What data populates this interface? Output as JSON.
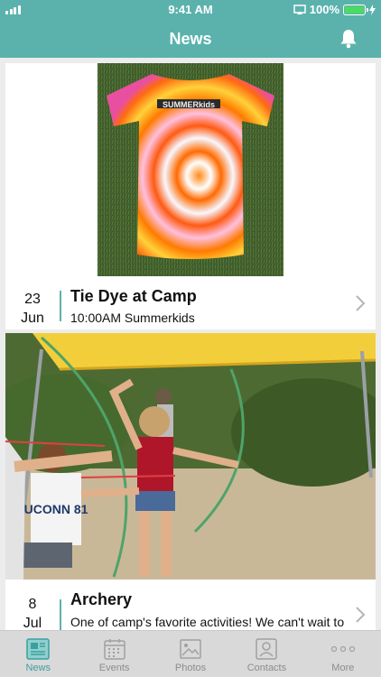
{
  "status": {
    "time": "9:41 AM",
    "battery": "100%"
  },
  "header": {
    "title": "News"
  },
  "events": [
    {
      "day": "23",
      "month": "Jun",
      "title": "Tie Dye at Camp",
      "subtitle": "10:00AM Summerkids",
      "image_text": "SUMMERkids"
    },
    {
      "day": "8",
      "month": "Jul",
      "title": "Archery",
      "subtitle": "One of camp's favorite activities! We can't wait to",
      "image_text": "UCONN 81"
    }
  ],
  "tabs": [
    {
      "label": "News",
      "icon": "newspaper-icon",
      "active": true
    },
    {
      "label": "Events",
      "icon": "calendar-icon",
      "active": false
    },
    {
      "label": "Photos",
      "icon": "photo-icon",
      "active": false
    },
    {
      "label": "Contacts",
      "icon": "contact-card-icon",
      "active": false
    },
    {
      "label": "More",
      "icon": "more-dots-icon",
      "active": false
    }
  ],
  "colors": {
    "primary": "#5bb2ad",
    "active_tab": "#3aa0a0",
    "inactive_tab": "#8c8c8c",
    "tabbar_bg": "#d9d9d9"
  }
}
